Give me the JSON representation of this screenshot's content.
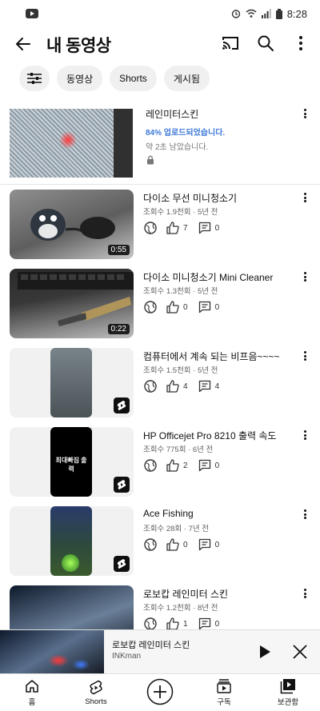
{
  "status": {
    "time": "8:28"
  },
  "header": {
    "title": "내 동영상"
  },
  "chips": [
    {
      "label": "동영상"
    },
    {
      "label": "Shorts"
    },
    {
      "label": "게시됨"
    }
  ],
  "upload": {
    "title": "레인미터스킨",
    "progress_text": "84% 업로드되었습니다.",
    "remaining_text": "약 2초 남았습니다.",
    "progress": 0.84
  },
  "videos": [
    {
      "title": "다이소 무선 미니청소기",
      "meta": "조회수 1.9천회 · 5년 전",
      "likes": "7",
      "comments": "0",
      "duration": "0:55",
      "type": "video"
    },
    {
      "title": "다이소 미니청소기 Mini Cleaner",
      "meta": "조회수 1.3천회 · 5년 전",
      "likes": "0",
      "comments": "0",
      "duration": "0:22",
      "type": "video"
    },
    {
      "title": "컴퓨터에서 계속 되는 비프음~~~~",
      "meta": "조회수 1.5천회 · 5년 전",
      "likes": "4",
      "comments": "4",
      "type": "short"
    },
    {
      "title": "HP Officejet Pro 8210 출력 속도",
      "meta": "조회수 775회 · 6년 전",
      "likes": "2",
      "comments": "0",
      "type": "short",
      "thumb_text": "최대빠짐 출력"
    },
    {
      "title": "Ace Fishing",
      "meta": "조회수 28회 · 7년 전",
      "likes": "0",
      "comments": "0",
      "type": "short"
    },
    {
      "title": "로보캅 레인미터 스킨",
      "meta": "조회수 1.2천회 · 8년 전",
      "likes": "1",
      "comments": "0",
      "type": "video"
    }
  ],
  "miniplayer": {
    "title": "로보캅 레인미터 스킨",
    "channel": "INKman"
  },
  "nav": {
    "home": "홈",
    "shorts": "Shorts",
    "subscriptions": "구독",
    "library": "보관함"
  },
  "icons": {
    "back": "arrow-left-icon",
    "cast": "cast-icon",
    "search": "search-icon",
    "more": "more-vertical-icon",
    "filter": "sliders-icon",
    "visibility": "globe-icon",
    "like": "thumb-up-icon",
    "comment": "comment-icon"
  },
  "colors": {
    "accent": "#3e79d8"
  }
}
